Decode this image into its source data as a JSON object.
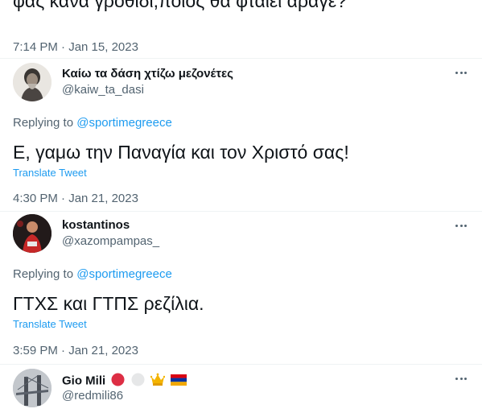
{
  "top_tweet": {
    "text": "φας κανα γροθιδι,ποιος θα φταιει αραγε?",
    "timestamp": "7:14 PM · Jan 15, 2023"
  },
  "replies": [
    {
      "display_name": "Καίω τα δάση χτίζω μεζονέτες",
      "handle": "@kaiw_ta_dasi",
      "replying_prefix": "Replying to ",
      "replying_to": "@sportimegreece",
      "text": "Ε, γαμω την Παναγία και τον Χριστό σας!",
      "translate": "Translate Tweet",
      "timestamp": "4:30 PM · Jan 21, 2023"
    },
    {
      "display_name": "kostantinos",
      "handle": "@xazompampas_",
      "replying_prefix": "Replying to ",
      "replying_to": "@sportimegreece",
      "text": "ΓΤΧΣ και ΓΤΠΣ ρεζίλια.",
      "translate": "Translate Tweet",
      "timestamp": "3:59 PM · Jan 21, 2023"
    },
    {
      "display_name": "Gio Mili",
      "handle": "@redmili86",
      "name_emojis": [
        "red-circle-icon",
        "white-circle-icon",
        "crown-icon",
        "armenia-flag-icon"
      ]
    }
  ],
  "colors": {
    "link": "#1d9bf0",
    "secondary_text": "#536471",
    "primary_text": "#0f1419",
    "divider": "#eff3f4"
  }
}
